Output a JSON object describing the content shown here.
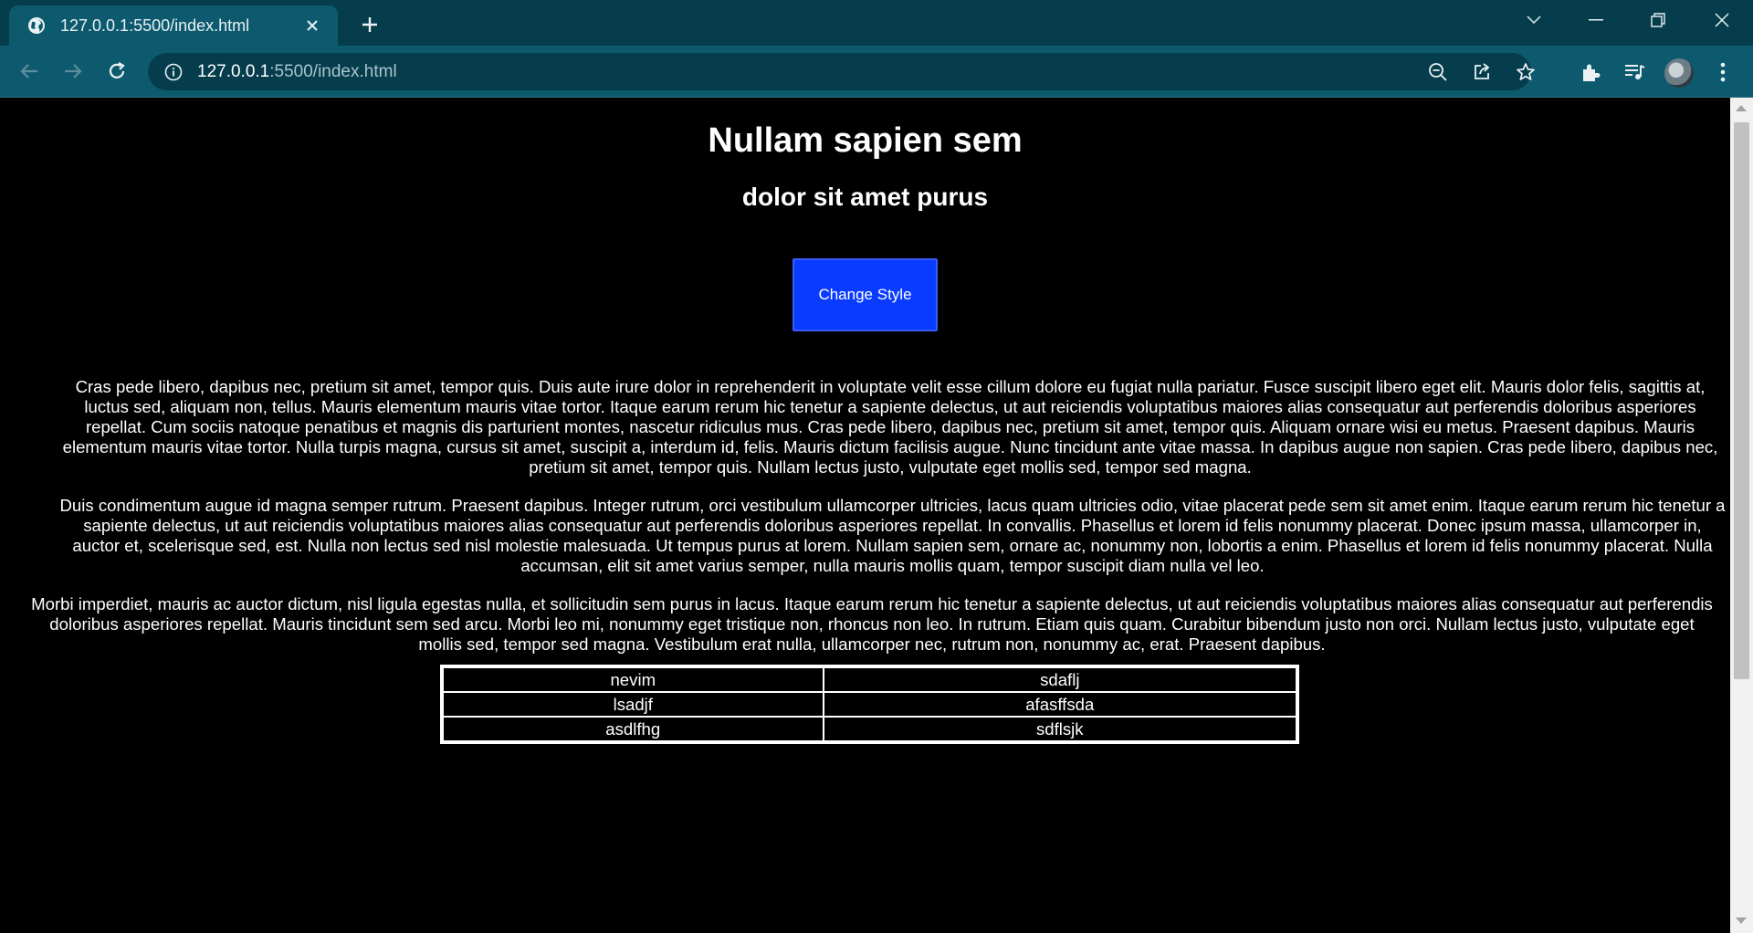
{
  "browser": {
    "tab_title": "127.0.0.1:5500/index.html",
    "url_host": "127.0.0.1",
    "url_path": ":5500/index.html"
  },
  "page": {
    "title": "Nullam sapien sem",
    "subtitle": "dolor sit amet purus",
    "button_label": "Change Style",
    "paragraphs": [
      "Cras pede libero, dapibus nec, pretium sit amet, tempor quis. Duis aute irure dolor in reprehenderit in voluptate velit esse cillum dolore eu fugiat nulla pariatur. Fusce suscipit libero eget elit. Mauris dolor felis, sagittis at, luctus sed, aliquam non, tellus. Mauris elementum mauris vitae tortor. Itaque earum rerum hic tenetur a sapiente delectus, ut aut reiciendis voluptatibus maiores alias consequatur aut perferendis doloribus asperiores repellat. Cum sociis natoque penatibus et magnis dis parturient montes, nascetur ridiculus mus. Cras pede libero, dapibus nec, pretium sit amet, tempor quis. Aliquam ornare wisi eu metus. Praesent dapibus. Mauris elementum mauris vitae tortor. Nulla turpis magna, cursus sit amet, suscipit a, interdum id, felis. Mauris dictum facilisis augue. Nunc tincidunt ante vitae massa. In dapibus augue non sapien. Cras pede libero, dapibus nec, pretium sit amet, tempor quis. Nullam lectus justo, vulputate eget mollis sed, tempor sed magna.",
      "Duis condimentum augue id magna semper rutrum. Praesent dapibus. Integer rutrum, orci vestibulum ullamcorper ultricies, lacus quam ultricies odio, vitae placerat pede sem sit amet enim. Itaque earum rerum hic tenetur a sapiente delectus, ut aut reiciendis voluptatibus maiores alias consequatur aut perferendis doloribus asperiores repellat. In convallis. Phasellus et lorem id felis nonummy placerat. Donec ipsum massa, ullamcorper in, auctor et, scelerisque sed, est. Nulla non lectus sed nisl molestie malesuada. Ut tempus purus at lorem. Nullam sapien sem, ornare ac, nonummy non, lobortis a enim. Phasellus et lorem id felis nonummy placerat. Nulla accumsan, elit sit amet varius semper, nulla mauris mollis quam, tempor suscipit diam nulla vel leo.",
      "Morbi imperdiet, mauris ac auctor dictum, nisl ligula egestas nulla, et sollicitudin sem purus in lacus. Itaque earum rerum hic tenetur a sapiente delectus, ut aut reiciendis voluptatibus maiores alias consequatur aut perferendis doloribus asperiores repellat. Mauris tincidunt sem sed arcu. Morbi leo mi, nonummy eget tristique non, rhoncus non leo. In rutrum. Etiam quis quam. Curabitur bibendum justo non orci. Nullam lectus justo, vulputate eget mollis sed, tempor sed magna. Vestibulum erat nulla, ullamcorper nec, rutrum non, nonummy ac, erat. Praesent dapibus."
    ],
    "table": [
      [
        "nevim",
        "sdaflj"
      ],
      [
        "lsadjf",
        "afasffsda"
      ],
      [
        "asdlfhg",
        "sdflsjk"
      ]
    ]
  },
  "colors": {
    "chrome_dark": "#063d4d",
    "chrome_light": "#0d5a6e",
    "button_blue": "#0a3cff",
    "page_bg": "#000000"
  },
  "icons": [
    "globe-icon",
    "close-icon",
    "plus-icon",
    "chevron-down-icon",
    "minimize-icon",
    "restore-icon",
    "back-icon",
    "forward-icon",
    "reload-icon",
    "info-icon",
    "zoom-out-icon",
    "share-icon",
    "star-icon",
    "extensions-icon",
    "media-icon",
    "menu-icon"
  ]
}
